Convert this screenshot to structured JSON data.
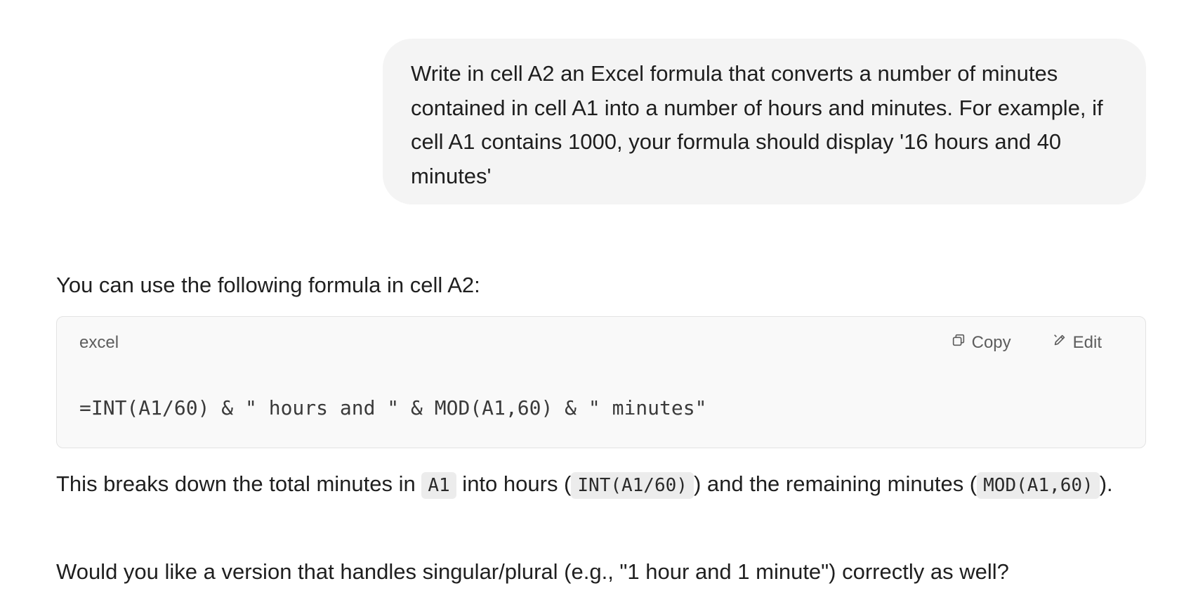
{
  "user_message": {
    "text": "Write in cell A2 an Excel formula that converts a number of minutes contained in cell A1 into a number of hours and minutes. For example, if cell A1 contains 1000, your formula should display '16 hours and 40 minutes'"
  },
  "assistant": {
    "intro": "You can use the following formula in cell A2:",
    "code_block": {
      "language": "excel",
      "copy_label": "Copy",
      "edit_label": "Edit",
      "copy_icon": "copy-icon",
      "edit_icon": "pencil-icon",
      "code": "=INT(A1/60) & \" hours and \" & MOD(A1,60) & \" minutes\""
    },
    "explanation": {
      "part1": "This breaks down the total minutes in ",
      "code1": "A1",
      "part2": " into hours (",
      "code2": "INT(A1/60)",
      "part3": ") and the remaining minutes (",
      "code3": "MOD(A1,60)",
      "part4": ")."
    },
    "followup": "Would you like a version that handles singular/plural (e.g., \"1 hour and 1 minute\") correctly as well?"
  },
  "colors": {
    "bubble_bg": "#f4f4f4",
    "code_bg": "#f9f9f9",
    "inline_code_bg": "#ececec",
    "text": "#1f1f1f"
  }
}
